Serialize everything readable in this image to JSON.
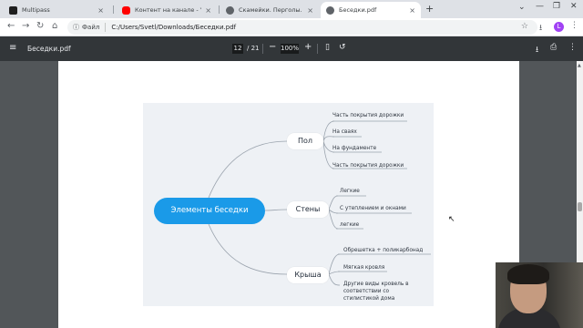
{
  "browser": {
    "tabs": [
      {
        "title": "Multipass",
        "active": false
      },
      {
        "title": "Контент на канале - YouTube S",
        "active": false
      },
      {
        "title": "Скамейки. Перголы. Шпалеры.",
        "active": false
      },
      {
        "title": "Беседки.pdf",
        "active": true
      }
    ],
    "omnibox": {
      "chip_label": "Файл",
      "url": "C:/Users/Svetl/Downloads/Беседки.pdf"
    },
    "avatar_letter": "L"
  },
  "pdf": {
    "filename": "Беседки.pdf",
    "page_current": "12",
    "page_total": "/ 21",
    "zoom": "100%"
  },
  "mindmap": {
    "central": "Элементы беседки",
    "branches": [
      {
        "label": "Пол",
        "leaves": [
          "Часть покрытия дорожки",
          "На сваях",
          "На фундаменте",
          "Часть покрытия дорожки"
        ]
      },
      {
        "label": "Стены",
        "leaves": [
          "Легкие",
          "С утеплением и окнами",
          "легкие"
        ]
      },
      {
        "label": "Крыша",
        "leaves": [
          "Обрешетка + поликарбонад",
          "Мягкая кровля",
          "Другие виды кровель в\nсоответствии со\nстилистикой дома"
        ]
      }
    ],
    "colors": {
      "central": "#1a9ae8",
      "background": "#eef1f5"
    }
  },
  "icons": {
    "menu": "menu-icon",
    "download": "download-icon",
    "print": "print-icon",
    "more": "more-icon"
  }
}
